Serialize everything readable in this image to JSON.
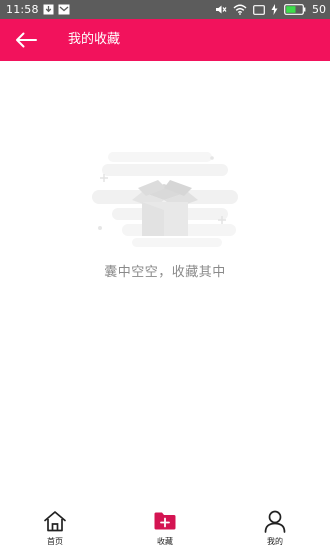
{
  "status_bar": {
    "time": "11:58",
    "battery": "50"
  },
  "header": {
    "title": "我的收藏",
    "back_icon": "arrow-left-icon"
  },
  "empty_state": {
    "message": "囊中空空，收藏其中",
    "icon": "empty-box-icon"
  },
  "bottom_nav": {
    "items": [
      {
        "label": "首页",
        "icon": "home-icon",
        "active": false
      },
      {
        "label": "收藏",
        "icon": "favorites-folder-icon",
        "active": true
      },
      {
        "label": "我的",
        "icon": "person-icon",
        "active": false
      }
    ]
  },
  "colors": {
    "accent": "#f2125c",
    "status_bar": "#5c5c5c",
    "empty_text": "#8a8a8a"
  }
}
